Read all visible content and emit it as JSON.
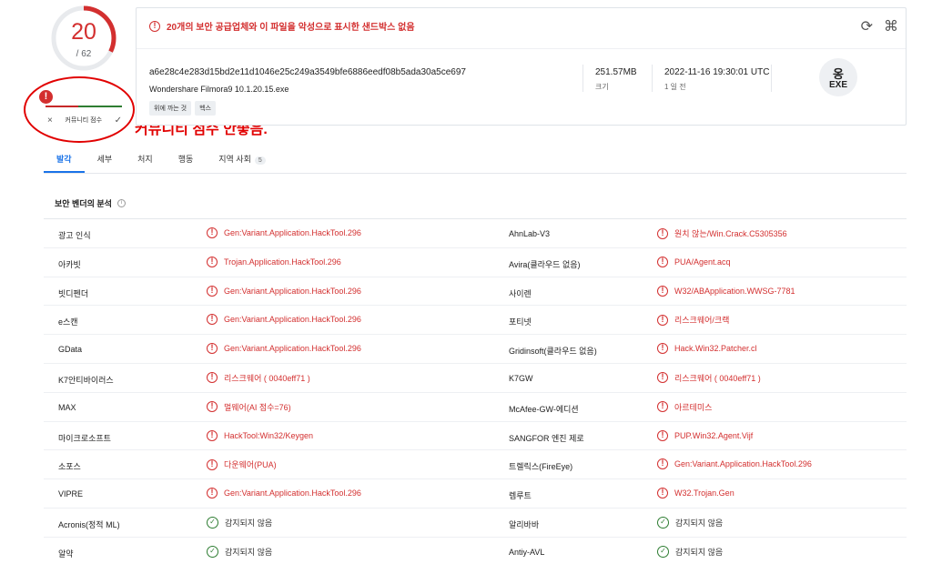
{
  "score": {
    "detections": "20",
    "total": "/ 62",
    "detection_ratio": 0.3226
  },
  "community": {
    "bad_icon": "!",
    "dismiss_icon": "×",
    "label": "커뮤니티 점수",
    "confirm_icon": "✓"
  },
  "annotation": {
    "text": "커뮤니티 점수 안좋음."
  },
  "alert": {
    "icon": "!",
    "text": "20개의 보안 공급업체와 이 파일을 악성으로 표시한 샌드박스 없음"
  },
  "top_icons": {
    "reanalyze": "⟳",
    "similar": "⌘"
  },
  "file": {
    "hash": "a6e28c4e283d15bd2e11d1046e25c249a3549bfe6886eedf08b5ada30a5ce697",
    "name": "Wondershare Filmora9 10.1.20.15.exe",
    "tags": [
      "위에 까는 것",
      "헥스"
    ],
    "size_value": "251.57MB",
    "size_label": "크기",
    "date_value": "2022-11-16 19:30:01 UTC",
    "date_label": "1 일 전",
    "type_label": "EXE",
    "type_glyph": "옹"
  },
  "tabs": [
    {
      "label": "발각",
      "active": true
    },
    {
      "label": "세부"
    },
    {
      "label": "처지"
    },
    {
      "label": "행동"
    },
    {
      "label": "지역 사회",
      "count": "5"
    }
  ],
  "section": {
    "title": "보안 벤더의 분석",
    "info_icon": "i"
  },
  "icons": {
    "alert": "!",
    "ok": "✓"
  },
  "vendors": [
    {
      "l_name": "광고 인식",
      "l_result": "Gen:Variant.Application.HackTool.296",
      "r_name": "AhnLab-V3",
      "r_result": "원치 않는/Win.Crack.C5305356"
    },
    {
      "l_name": "아카빗",
      "l_result": "Trojan.Application.HackTool.296",
      "r_name": "Avira(클라우드 없음)",
      "r_result": "PUA/Agent.acq"
    },
    {
      "l_name": "빗디펜더",
      "l_result": "Gen:Variant.Application.HackTool.296",
      "r_name": "사이렌",
      "r_result": "W32/ABApplication.WWSG-7781"
    },
    {
      "l_name": "e스캔",
      "l_result": "Gen:Variant.Application.HackTool.296",
      "r_name": "포티넷",
      "r_result": "리스크웨어/크랙"
    },
    {
      "l_name": "GData",
      "l_result": "Gen:Variant.Application.HackTool.296",
      "r_name": "Gridinsoft(클라우드 없음)",
      "r_result": "Hack.Win32.Patcher.cl"
    },
    {
      "l_name": "K7안티바이러스",
      "l_result": "리스크웨어 ( 0040eff71 )",
      "r_name": "K7GW",
      "r_result": "리스크웨어 ( 0040eff71 )"
    },
    {
      "l_name": "MAX",
      "l_result": "멀웨어(AI 점수=76)",
      "r_name": "McAfee-GW-에디션",
      "r_result": "아르테미스"
    },
    {
      "l_name": "마이크로소프트",
      "l_result": "HackTool:Win32/Keygen",
      "r_name": "SANGFOR 엔진 제로",
      "r_result": "PUP.Win32.Agent.Vijf"
    },
    {
      "l_name": "소포스",
      "l_result": "다운웨어(PUA)",
      "r_name": "트렐릭스(FireEye)",
      "r_result": "Gen:Variant.Application.HackTool.296"
    },
    {
      "l_name": "VIPRE",
      "l_result": "Gen:Variant.Application.HackTool.296",
      "r_name": "렘루트",
      "r_result": "W32.Trojan.Gen"
    },
    {
      "l_name": "Acronis(정적 ML)",
      "l_result": "감지되지 않음",
      "l_ok": true,
      "r_name": "알리바바",
      "r_result": "감지되지 않음",
      "r_ok": true
    },
    {
      "l_name": "알약",
      "l_result": "감지되지 않음",
      "l_ok": true,
      "r_name": "Antiy-AVL",
      "r_result": "감지되지 않음",
      "r_ok": true
    }
  ]
}
